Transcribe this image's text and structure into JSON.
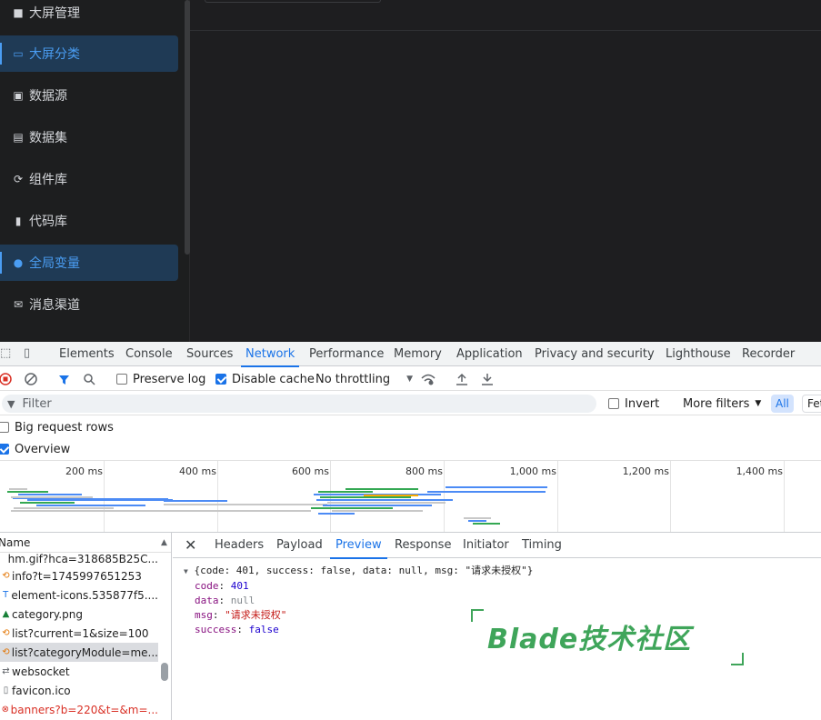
{
  "sidebar": {
    "items": [
      {
        "label": "大屏管理",
        "icon": "grid-icon"
      },
      {
        "label": "大屏分类",
        "icon": "folder-icon",
        "active": true
      },
      {
        "label": "数据源",
        "icon": "database-icon"
      },
      {
        "label": "数据集",
        "icon": "dataset-icon"
      },
      {
        "label": "组件库",
        "icon": "component-icon"
      },
      {
        "label": "代码库",
        "icon": "code-icon"
      },
      {
        "label": "全局变量",
        "icon": "bulb-icon",
        "active": true
      },
      {
        "label": "消息渠道",
        "icon": "mail-icon"
      }
    ]
  },
  "devtools": {
    "tabs": [
      "Elements",
      "Console",
      "Sources",
      "Network",
      "Performance",
      "Memory",
      "Application",
      "Privacy and security",
      "Lighthouse",
      "Recorder"
    ],
    "active_tab": "Network",
    "toolbar": {
      "preserve_log": "Preserve log",
      "disable_cache": "Disable cache",
      "throttling": "No throttling"
    },
    "filter": {
      "placeholder": "Filter",
      "invert": "Invert",
      "more_filters": "More filters",
      "all": "All",
      "fetch_partial": "Fet"
    },
    "options": {
      "big_rows": "Big request rows",
      "overview": "Overview"
    },
    "timeline_ticks": [
      "200 ms",
      "400 ms",
      "600 ms",
      "800 ms",
      "1,000 ms",
      "1,200 ms",
      "1,400 ms"
    ],
    "request_list": {
      "header": "Name",
      "rows": [
        {
          "name": "hm.gif?hca=318685B25C...",
          "icon": "image-icon"
        },
        {
          "name": "info?t=1745997651253",
          "icon": "xhr-icon"
        },
        {
          "name": "element-icons.535877f5....",
          "icon": "font-icon"
        },
        {
          "name": "category.png",
          "icon": "image-icon"
        },
        {
          "name": "list?current=1&size=100",
          "icon": "xhr-icon"
        },
        {
          "name": "list?categoryModule=me...",
          "icon": "xhr-icon",
          "selected": true
        },
        {
          "name": "websocket",
          "icon": "websocket-icon"
        },
        {
          "name": "favicon.ico",
          "icon": "document-icon"
        },
        {
          "name": "banners?b=220&t=&m=...",
          "icon": "error-icon",
          "error": true
        }
      ]
    },
    "detail_tabs": [
      "Headers",
      "Payload",
      "Preview",
      "Response",
      "Initiator",
      "Timing"
    ],
    "active_detail_tab": "Preview",
    "preview": {
      "summary": "{code: 401, success: false, data: null, msg: \"请求未授权\"}",
      "code_key": "code",
      "code_val": "401",
      "data_key": "data",
      "data_val": "null",
      "msg_key": "msg",
      "msg_val": "\"请求未授权\"",
      "success_key": "success",
      "success_val": "false"
    }
  },
  "watermark": {
    "text": "Blade技术社区"
  },
  "colors": {
    "accent": "#1a73e8",
    "sidebar_active": "#4a9df3",
    "watermark": "#3fa55a",
    "error": "#d93025"
  }
}
